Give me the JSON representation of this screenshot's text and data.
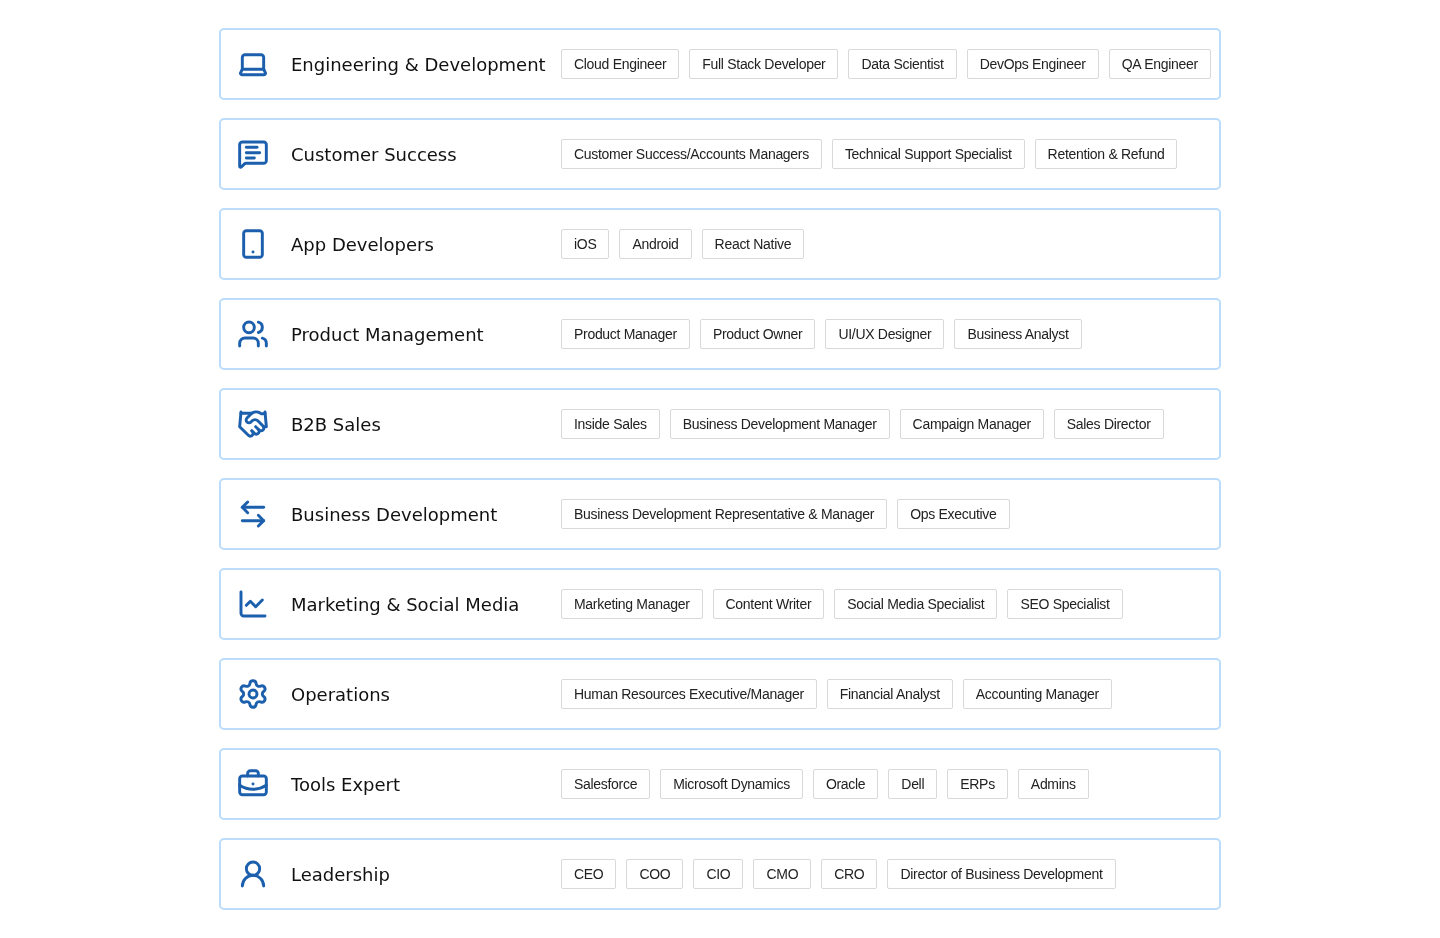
{
  "categories": [
    {
      "title": "Engineering & Development",
      "roles": [
        "Cloud Engineer",
        "Full Stack Developer",
        "Data Scientist",
        "DevOps Engineer",
        "QA Engineer"
      ]
    },
    {
      "title": "Customer Success",
      "roles": [
        "Customer Success/Accounts Managers",
        "Technical Support Specialist",
        "Retention & Refund"
      ]
    },
    {
      "title": "App Developers",
      "roles": [
        "iOS",
        "Android",
        "React Native"
      ]
    },
    {
      "title": "Product Management",
      "roles": [
        "Product Manager",
        "Product Owner",
        "UI/UX Designer",
        "Business Analyst"
      ]
    },
    {
      "title": "B2B Sales",
      "roles": [
        "Inside Sales",
        "Business Development Manager",
        "Campaign Manager",
        "Sales Director"
      ]
    },
    {
      "title": "Business Development",
      "roles": [
        "Business Development Representative & Manager",
        "Ops Executive"
      ]
    },
    {
      "title": "Marketing & Social Media",
      "roles": [
        "Marketing Manager",
        "Content Writer",
        "Social Media Specialist",
        "SEO Specialist"
      ]
    },
    {
      "title": "Operations",
      "roles": [
        "Human Resources Executive/Manager",
        "Financial Analyst",
        "Accounting Manager"
      ]
    },
    {
      "title": "Tools Expert",
      "roles": [
        "Salesforce",
        "Microsoft Dynamics",
        "Oracle",
        "Dell",
        "ERPs",
        "Admins"
      ]
    },
    {
      "title": "Leadership",
      "roles": [
        "CEO",
        "COO",
        "CIO",
        "CMO",
        "CRO",
        "Director of Business Development"
      ]
    }
  ]
}
